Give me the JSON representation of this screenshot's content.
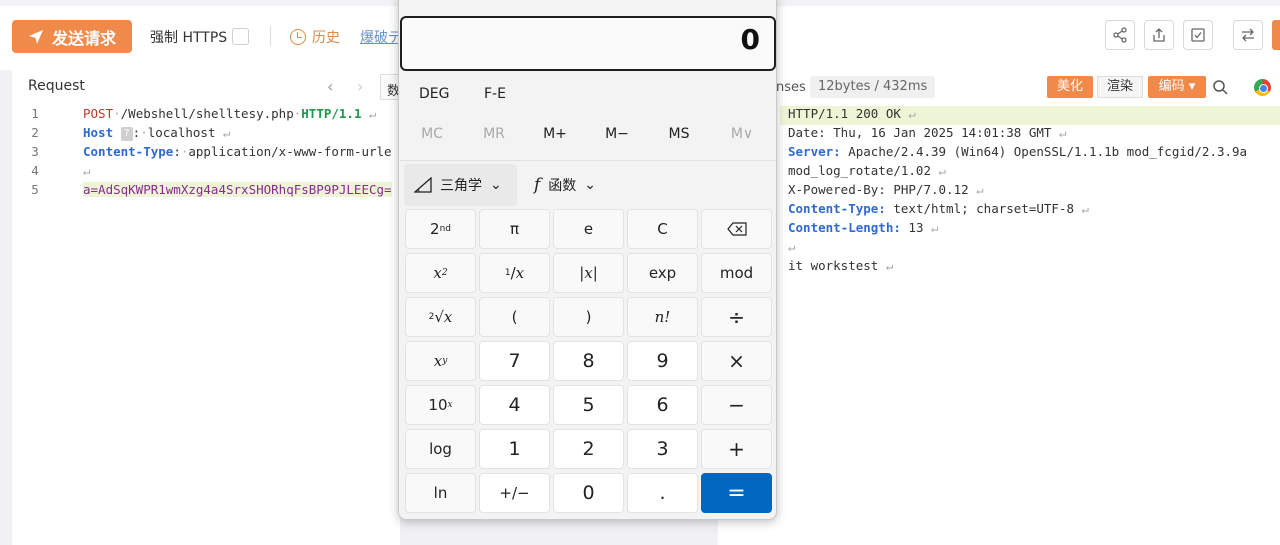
{
  "toolbar": {
    "send_label": "发送请求",
    "https_label": "强制 HTTPS",
    "history_label": "历史",
    "burst_label": "爆破デ"
  },
  "request": {
    "title": "Request",
    "tab_label": "数",
    "lines": [
      {
        "num": "1",
        "method": "POST",
        "path": "/Webshell/shelltesy.php",
        "proto": "HTTP/1.1"
      },
      {
        "num": "2",
        "key": "Host",
        "badge": "?",
        "value": "localhost"
      },
      {
        "num": "3",
        "key": "Content-Type",
        "value": "application/x-www-form-urle"
      },
      {
        "num": "4",
        "value": ""
      },
      {
        "num": "5",
        "value": "a=AdSqKWPR1wmXzg4a4SrxSHORhqFsBP9PJLEECg="
      }
    ]
  },
  "response": {
    "title": "nses",
    "size": "12bytes / 432ms",
    "beautify_label": "美化",
    "render_label": "渲染",
    "encode_label": "编码",
    "lines": {
      "status": "HTTP/1.1 200 OK",
      "date": "Date: Thu, 16 Jan 2025 14:01:38 GMT",
      "server_key": "Server:",
      "server_val": "Apache/2.4.39 (Win64) OpenSSL/1.1.1b mod_fcgid/2.3.9a",
      "server_cont": "mod_log_rotate/1.02",
      "powered": "X-Powered-By: PHP/7.0.12",
      "ctype_key": "Content-Type:",
      "ctype_val": "text/html; charset=UTF-8",
      "clen_key": "Content-Length:",
      "clen_val": "13",
      "body": "it workstest"
    }
  },
  "calculator": {
    "display": "0",
    "modes": {
      "deg": "DEG",
      "fe": "F-E"
    },
    "memory": [
      "MC",
      "MR",
      "M+",
      "M−",
      "MS",
      "M∨"
    ],
    "trig_label": "三角学",
    "func_label": "函数",
    "keys": {
      "pi": "π",
      "e": "e",
      "clear": "C",
      "abs": "|x|",
      "exp": "exp",
      "mod": "mod",
      "lparen": "(",
      "rparen": ")",
      "fact": "n!",
      "div": "÷",
      "n7": "7",
      "n8": "8",
      "n9": "9",
      "mul": "×",
      "n4": "4",
      "n5": "5",
      "n6": "6",
      "minus": "−",
      "log": "log",
      "n1": "1",
      "n2": "2",
      "n3": "3",
      "plus": "+",
      "ln": "ln",
      "negate": "+/−",
      "n0": "0",
      "dot": ".",
      "eq": "="
    }
  },
  "colors": {
    "accent": "#f08a4b",
    "equals": "#0067c0",
    "link": "#6a8fc7"
  }
}
